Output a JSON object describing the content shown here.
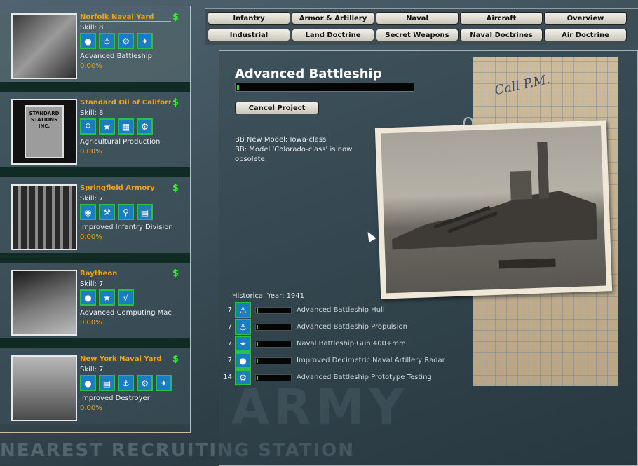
{
  "background": {
    "watermark": "NEAREST RECRUITING STATION",
    "poster_word": "ARMY"
  },
  "tabs_row1": [
    "Infantry",
    "Armor & Artillery",
    "Naval",
    "Aircraft",
    "Overview"
  ],
  "tabs_row2": [
    "Industrial",
    "Land Doctrine",
    "Secret Weapons",
    "Naval Doctrines",
    "Air Doctrine"
  ],
  "teams": [
    {
      "name": "Norfolk Naval Yard",
      "skill": "Skill: 8",
      "project": "Advanced Battleship",
      "progress": "0.00%",
      "icons": [
        "bulb-icon",
        "anchor-icon",
        "gear-icon",
        "naval-gun-icon"
      ],
      "selected": true
    },
    {
      "name": "Standard Oil of Californi",
      "skill": "Skill: 8",
      "project": "Agricultural Production",
      "progress": "0.00%",
      "icons": [
        "flask-icon",
        "star-icon",
        "factory-icon",
        "gear-icon"
      ],
      "selected": false,
      "photo_text": "STANDARD STATIONS INC."
    },
    {
      "name": "Springfield Armory",
      "skill": "Skill: 7",
      "project": "Improved Infantry Division",
      "progress": "0.00%",
      "icons": [
        "grenade-icon",
        "wrench-icon",
        "flask-icon",
        "computer-icon"
      ],
      "selected": false
    },
    {
      "name": "Raytheon",
      "skill": "Skill: 7",
      "project": "Advanced Computing Mac",
      "progress": "0.00%",
      "icons": [
        "bulb-icon",
        "star-icon",
        "sqrt-icon"
      ],
      "selected": false
    },
    {
      "name": "New York Naval Yard",
      "skill": "Skill: 7",
      "project": "Improved Destroyer",
      "progress": "0.00%",
      "icons": [
        "bulb-icon",
        "computer-icon",
        "anchor-icon",
        "gear-icon",
        "naval-gun-icon"
      ],
      "selected": false
    }
  ],
  "project": {
    "title": "Advanced Battleship",
    "progress_fraction": 0.01,
    "cancel_label": "Cancel Project",
    "effect_line1": "BB New Model: Iowa-class",
    "effect_line2": "BB: Model 'Colorado-class' is now obsolete.",
    "historical_year": "Historical Year: 1941",
    "notebook_scribble": "Call P.M."
  },
  "components": [
    {
      "skill": "7",
      "icon": "anchor-icon",
      "name": "Advanced Battleship Hull",
      "progress_fraction": 0.04
    },
    {
      "skill": "7",
      "icon": "anchor-icon",
      "name": "Advanced Battleship Propulsion",
      "progress_fraction": 0.04
    },
    {
      "skill": "7",
      "icon": "naval-gun-icon",
      "name": "Naval Battleship Gun 400+mm",
      "progress_fraction": 0.04
    },
    {
      "skill": "7",
      "icon": "bulb-icon",
      "name": "Improved Decimetric Naval Artillery Radar",
      "progress_fraction": 0.04
    },
    {
      "skill": "14",
      "icon": "gear-icon",
      "name": "Advanced Battleship Prototype Testing",
      "progress_fraction": 0.04
    }
  ],
  "colors": {
    "team_name": "#f2a310",
    "progress_green": "#2fd33b",
    "icon_blue": "#1a7dc2",
    "icon_border": "#29c04a"
  }
}
